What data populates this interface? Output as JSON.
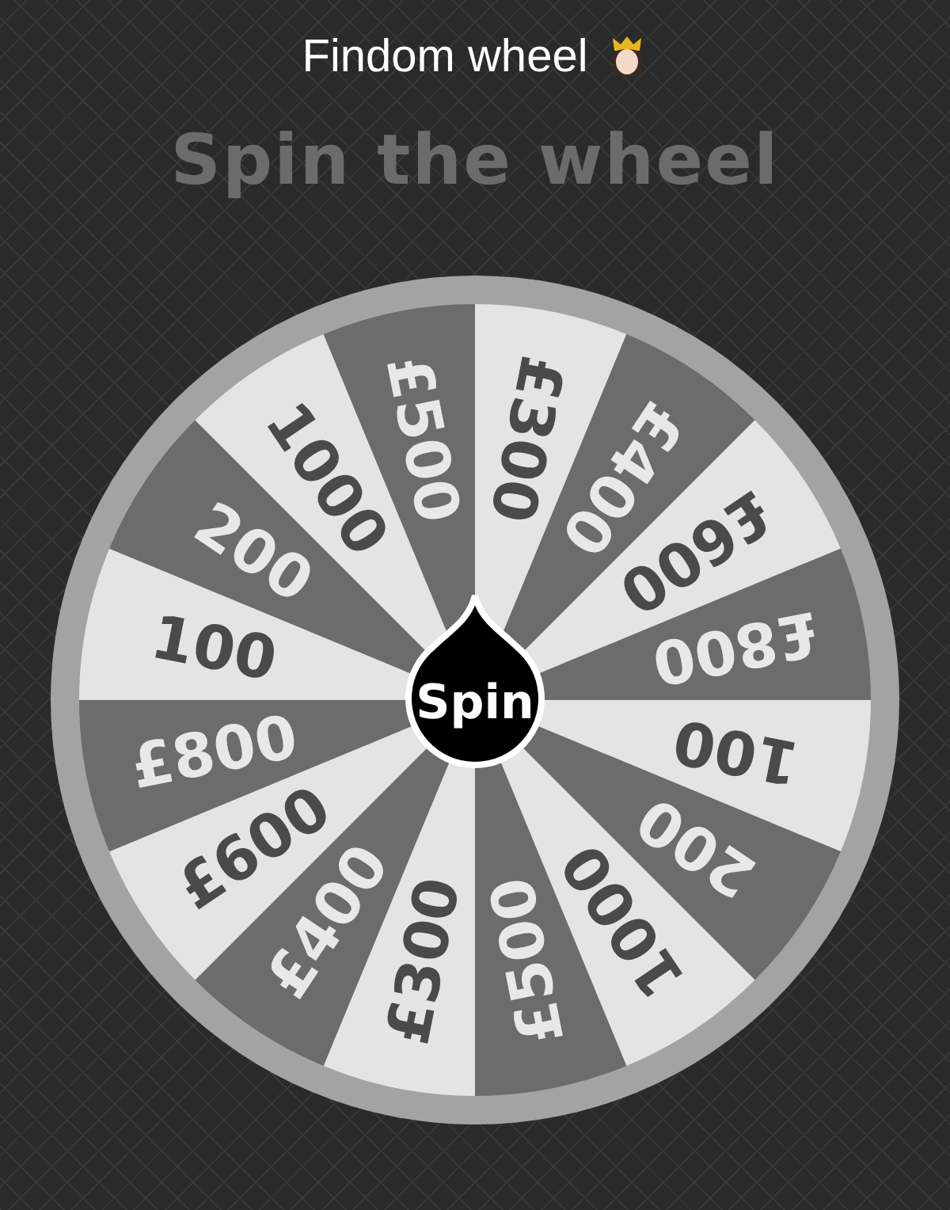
{
  "title": "Findom wheel",
  "heading": "Spin the wheel",
  "wheel": {
    "spin_button": "Spin",
    "segments": [
      {
        "label": "£300",
        "color": "#e4e4e4"
      },
      {
        "label": "£400",
        "color": "#6c6c6c"
      },
      {
        "label": "£600",
        "color": "#e4e4e4"
      },
      {
        "label": "£800",
        "color": "#6c6c6c"
      },
      {
        "label": "100",
        "color": "#e4e4e4"
      },
      {
        "label": "200",
        "color": "#6c6c6c"
      },
      {
        "label": "1000",
        "color": "#e4e4e4"
      },
      {
        "label": "£500",
        "color": "#6c6c6c"
      },
      {
        "label": "£300",
        "color": "#e4e4e4"
      },
      {
        "label": "£400",
        "color": "#6c6c6c"
      },
      {
        "label": "£600",
        "color": "#e4e4e4"
      },
      {
        "label": "£800",
        "color": "#6c6c6c"
      },
      {
        "label": "100",
        "color": "#e4e4e4"
      },
      {
        "label": "200",
        "color": "#6c6c6c"
      },
      {
        "label": "1000",
        "color": "#e4e4e4"
      },
      {
        "label": "£500",
        "color": "#6c6c6c"
      }
    ]
  }
}
